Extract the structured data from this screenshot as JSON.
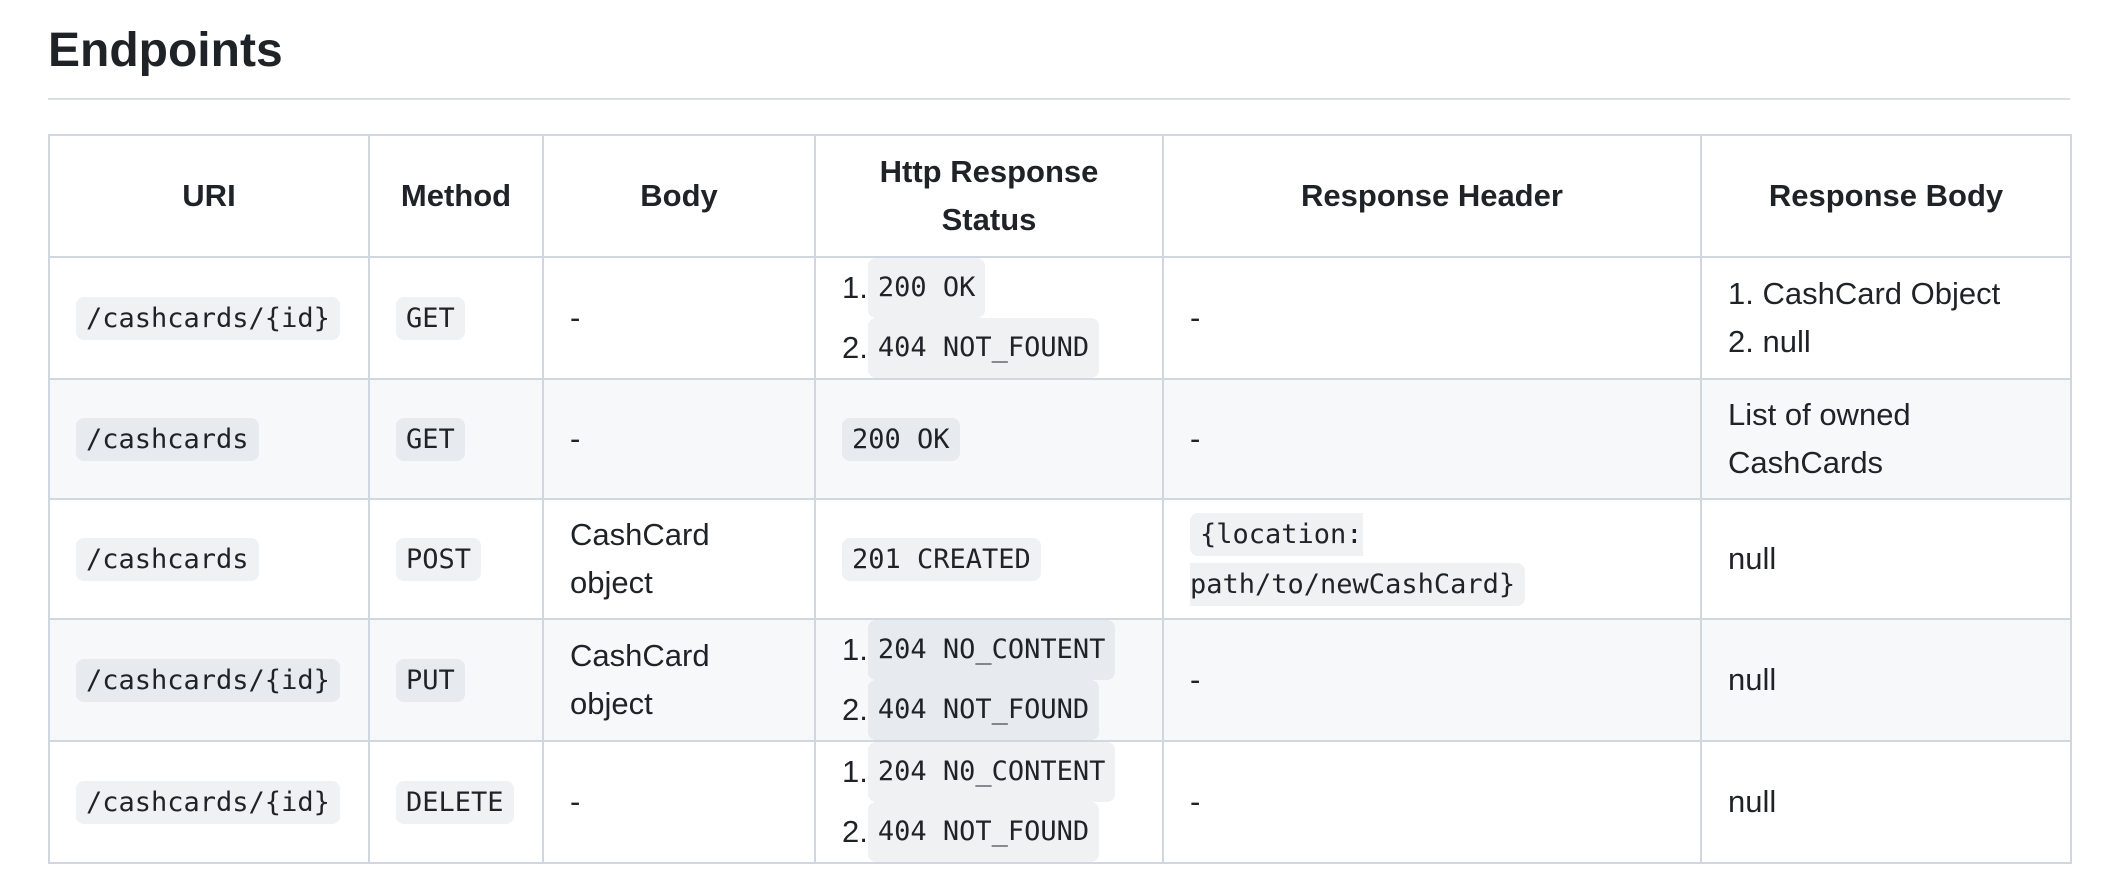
{
  "section": {
    "title": "Endpoints"
  },
  "columns": [
    "URI",
    "Method",
    "Body",
    "Http Response Status",
    "Response Header",
    "Response Body"
  ],
  "rows": [
    {
      "uri": "/cashcards/{id}",
      "method": "GET",
      "body": "-",
      "status": [
        {
          "num": "1.",
          "text": "200 OK"
        },
        {
          "num": "2.",
          "text": "404 NOT_FOUND"
        }
      ],
      "header": "-",
      "response": [
        {
          "num": "1.",
          "text": "CashCard Object"
        },
        {
          "num": "2.",
          "text": "null"
        }
      ]
    },
    {
      "uri": "/cashcards",
      "method": "GET",
      "body": "-",
      "status_single": "200 OK",
      "header": "-",
      "response_text": "List of owned CashCards"
    },
    {
      "uri": "/cashcards",
      "method": "POST",
      "body": "CashCard object",
      "status_single": "201 CREATED",
      "header_code": "{location: path/to/newCashCard}",
      "response_text": "null"
    },
    {
      "uri": "/cashcards/{id}",
      "method": "PUT",
      "body": "CashCard object",
      "status": [
        {
          "num": "1.",
          "text": "204 NO_CONTENT"
        },
        {
          "num": "2.",
          "text": "404 NOT_FOUND"
        }
      ],
      "header": "-",
      "response_text": "null"
    },
    {
      "uri": "/cashcards/{id}",
      "method": "DELETE",
      "body": "-",
      "status": [
        {
          "num": "1.",
          "text": "204 N0_CONTENT"
        },
        {
          "num": "2.",
          "text": "404 NOT_FOUND"
        }
      ],
      "header": "-",
      "response_text": "null"
    }
  ]
}
